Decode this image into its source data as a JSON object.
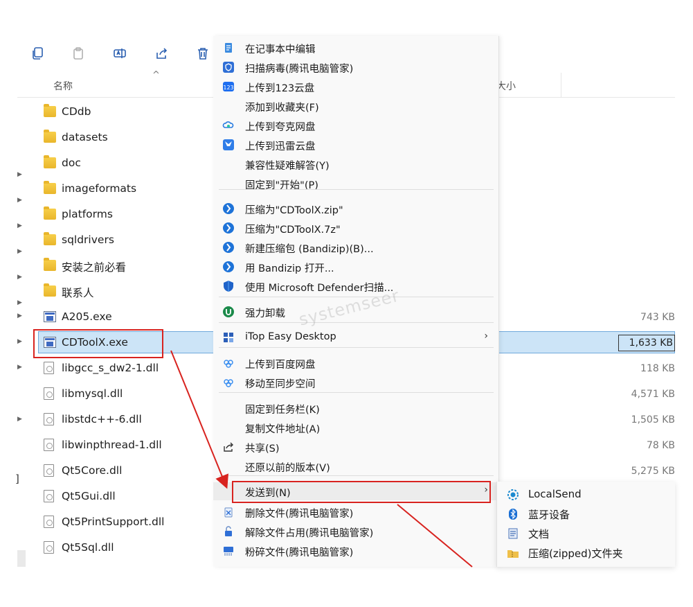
{
  "header": {
    "name_label": "名称",
    "size_label": "大小",
    "sort_arrow": "^"
  },
  "toolbar": {
    "icons": [
      "copy-icon",
      "paste-icon",
      "rename-icon",
      "share-icon",
      "delete-icon"
    ]
  },
  "files": [
    {
      "name": "CDdb",
      "type": "folder",
      "size": ""
    },
    {
      "name": "datasets",
      "type": "folder",
      "size": ""
    },
    {
      "name": "doc",
      "type": "folder",
      "size": ""
    },
    {
      "name": "imageformats",
      "type": "folder",
      "size": ""
    },
    {
      "name": "platforms",
      "type": "folder",
      "size": ""
    },
    {
      "name": "sqldrivers",
      "type": "folder",
      "size": ""
    },
    {
      "name": "安装之前必看",
      "type": "folder",
      "size": ""
    },
    {
      "name": "联系人",
      "type": "folder",
      "size": ""
    },
    {
      "name": "A205.exe",
      "type": "exe",
      "size": "743 KB"
    },
    {
      "name": "CDToolX.exe",
      "type": "exe",
      "size": "1,633 KB",
      "selected": true
    },
    {
      "name": "libgcc_s_dw2-1.dll",
      "type": "dll",
      "size": "118 KB"
    },
    {
      "name": "libmysql.dll",
      "type": "dll",
      "size": "4,571 KB"
    },
    {
      "name": "libstdc++-6.dll",
      "type": "dll",
      "size": "1,505 KB"
    },
    {
      "name": "libwinpthread-1.dll",
      "type": "dll",
      "size": "78 KB"
    },
    {
      "name": "Qt5Core.dll",
      "type": "dll",
      "size": "5,275 KB"
    },
    {
      "name": "Qt5Gui.dll",
      "type": "dll",
      "size": ""
    },
    {
      "name": "Qt5PrintSupport.dll",
      "type": "dll",
      "size": ""
    },
    {
      "name": "Qt5Sql.dll",
      "type": "dll",
      "size": ""
    }
  ],
  "context_menu": {
    "items": [
      {
        "label": "在记事本中编辑",
        "icon": "notepad-icon"
      },
      {
        "label": "扫描病毒(腾讯电脑管家)",
        "icon": "tencent-shield-icon"
      },
      {
        "label": "上传到123云盘",
        "icon": "cloud123-icon"
      },
      {
        "label": "添加到收藏夹(F)",
        "icon": ""
      },
      {
        "label": "上传到夸克网盘",
        "icon": "quark-cloud-icon"
      },
      {
        "label": "上传到迅雷云盘",
        "icon": "xunlei-icon"
      },
      {
        "label": "兼容性疑难解答(Y)",
        "icon": ""
      },
      {
        "label": "固定到\"开始\"(P)",
        "icon": ""
      },
      {
        "label": "压缩为\"CDToolX.zip\"",
        "icon": "bandizip-icon"
      },
      {
        "label": "压缩为\"CDToolX.7z\"",
        "icon": "bandizip-icon"
      },
      {
        "label": "新建压缩包 (Bandizip)(B)...",
        "icon": "bandizip-icon"
      },
      {
        "label": "用 Bandizip 打开...",
        "icon": "bandizip-icon"
      },
      {
        "label": "使用 Microsoft Defender扫描...",
        "icon": "defender-icon"
      },
      {
        "label": "强力卸载",
        "icon": "iobit-uninstall-icon"
      },
      {
        "label": "iTop Easy Desktop",
        "icon": "itop-icon",
        "submenu": true
      },
      {
        "label": "上传到百度网盘",
        "icon": "baidu-cloud-icon"
      },
      {
        "label": "移动至同步空间",
        "icon": "baidu-sync-icon"
      },
      {
        "label": "固定到任务栏(K)",
        "icon": ""
      },
      {
        "label": "复制文件地址(A)",
        "icon": ""
      },
      {
        "label": "共享(S)",
        "icon": "share-icon"
      },
      {
        "label": "还原以前的版本(V)",
        "icon": ""
      },
      {
        "label": "发送到(N)",
        "icon": "",
        "submenu": true,
        "highlighted": true
      },
      {
        "label": "删除文件(腾讯电脑管家)",
        "icon": "tencent-delete-icon"
      },
      {
        "label": "解除文件占用(腾讯电脑管家)",
        "icon": "tencent-unlock-icon"
      },
      {
        "label": "粉碎文件(腾讯电脑管家)",
        "icon": "tencent-shred-icon"
      }
    ],
    "submenu_arrow": "›"
  },
  "send_to_menu": {
    "items": [
      {
        "label": "LocalSend",
        "icon": "localsend-icon"
      },
      {
        "label": "蓝牙设备",
        "icon": "bluetooth-icon"
      },
      {
        "label": "文档",
        "icon": "documents-icon"
      },
      {
        "label": "压缩(zipped)文件夹",
        "icon": "zip-folder-icon"
      }
    ]
  },
  "watermark": "systemseer",
  "edge_mark": "]",
  "colors": {
    "accent": "#0067c0",
    "selection": "#cce4f7",
    "annotation": "#d8231f",
    "folder": "#f0c236"
  }
}
